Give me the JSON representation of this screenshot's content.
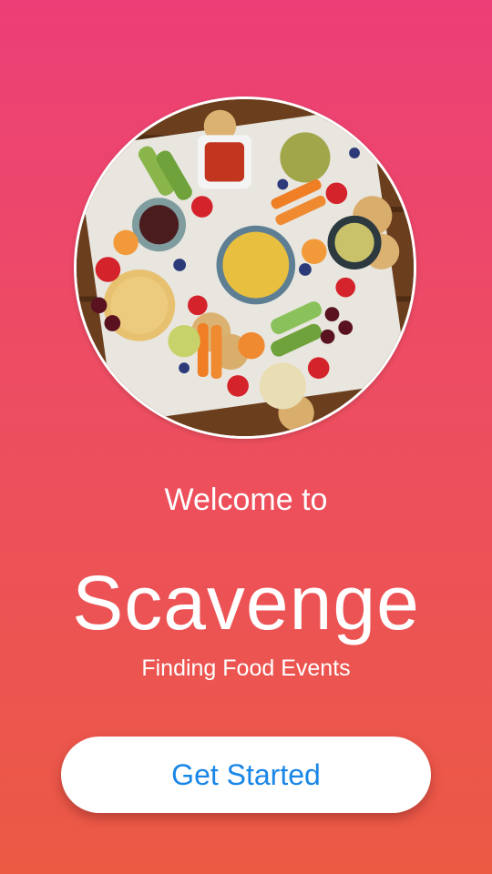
{
  "welcome": {
    "greeting": "Welcome to",
    "app_name": "Scavenge",
    "tagline": "Finding Food Events"
  },
  "actions": {
    "get_started_label": "Get Started"
  },
  "colors": {
    "background_top": "#ec3f77",
    "background_bottom": "#ec5a44",
    "button_text": "#1a86e6",
    "button_bg": "#ffffff"
  }
}
